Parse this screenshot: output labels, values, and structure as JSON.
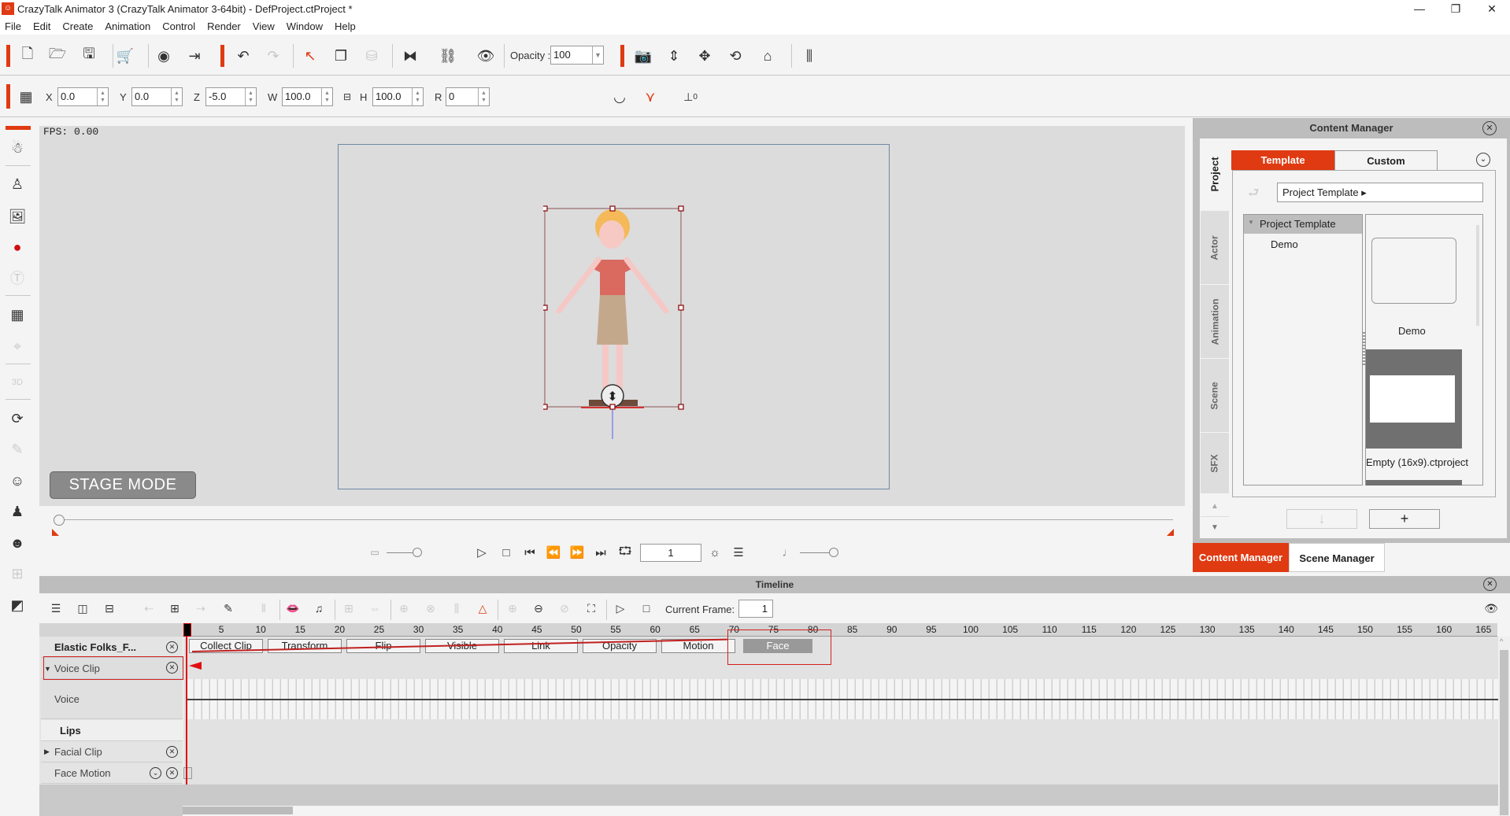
{
  "window": {
    "title": "CrazyTalk Animator 3  (CrazyTalk Animator 3-64bit) - DefProject.ctProject *",
    "controls": {
      "minimize": "—",
      "restore": "❐",
      "close": "✕"
    }
  },
  "menu": [
    "File",
    "Edit",
    "Create",
    "Animation",
    "Control",
    "Render",
    "View",
    "Window",
    "Help"
  ],
  "toolbar": {
    "icons": [
      "new-file",
      "open-folder",
      "save",
      "store-cart",
      "preview",
      "export",
      "undo",
      "redo",
      "select-arrow",
      "duplicate",
      "paint-bucket",
      "flip",
      "link",
      "visibility-eye",
      "camera",
      "move-vertical",
      "move-all",
      "rotate",
      "home",
      "sidebar-toggle"
    ],
    "opacity_label": "Opacity :",
    "opacity_value": "100"
  },
  "transform": {
    "x_label": "X",
    "x": "0.0",
    "y_label": "Y",
    "y": "0.0",
    "z_label": "Z",
    "z": "-5.0",
    "w_label": "W",
    "w": "100.0",
    "h_label": "H",
    "h": "100.0",
    "r_label": "R",
    "r": "0",
    "ground_label": "0"
  },
  "viewport": {
    "fps": "FPS: 0.00",
    "stage_mode": "STAGE MODE",
    "current_frame": "1"
  },
  "content_manager": {
    "title": "Content Manager",
    "side_tabs": [
      "Project",
      "Actor",
      "Animation",
      "Scene",
      "SFX"
    ],
    "tabs": {
      "template": "Template",
      "custom": "Custom"
    },
    "path": "Project Template ▸",
    "tree_header": "Project Template",
    "tree_items": [
      "Demo"
    ],
    "thumbs": [
      {
        "label": "Demo"
      },
      {
        "label": "Empty (16x9).ctproject"
      }
    ],
    "add_button": "+",
    "down_button": "↓",
    "bottom_tabs": {
      "content": "Content Manager",
      "scene": "Scene Manager"
    }
  },
  "timeline": {
    "title": "Timeline",
    "current_frame_label": "Current Frame:",
    "current_frame": "1",
    "ticks": [
      "5",
      "10",
      "15",
      "20",
      "25",
      "30",
      "35",
      "40",
      "45",
      "50",
      "55",
      "60",
      "65",
      "70",
      "75",
      "80",
      "85",
      "90",
      "95",
      "100",
      "105",
      "110",
      "115",
      "120",
      "125",
      "130",
      "135",
      "140",
      "145",
      "150",
      "155",
      "160",
      "165"
    ],
    "actor": "Elastic Folks_F...",
    "clip_buttons": [
      "Collect Clip",
      "Transform",
      "Flip",
      "Visible",
      "Link",
      "Opacity",
      "Motion",
      "Face"
    ],
    "tracks": {
      "voice_clip": "Voice Clip",
      "voice": "Voice",
      "lips": "Lips",
      "facial_clip": "Facial Clip",
      "face_motion": "Face Motion"
    }
  },
  "colors": {
    "accent": "#e03a12",
    "highlight": "#d02020"
  }
}
